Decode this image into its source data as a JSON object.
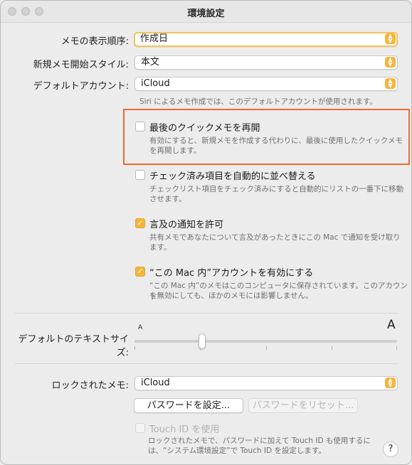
{
  "window": {
    "title": "環境設定"
  },
  "sort": {
    "label": "メモの表示順序:",
    "value": "作成日"
  },
  "new_note_style": {
    "label": "新規メモ開始スタイル:",
    "value": "本文"
  },
  "default_account": {
    "label": "デフォルトアカウント:",
    "value": "iCloud",
    "note": "Siri によるメモ作成では、このデフォルトアカウントが使用されます。"
  },
  "options": [
    {
      "label": "最後のクイックメモを再開",
      "checked": false,
      "note_line1": "有効にすると、新規メモを作成する代わりに、最後に使用したクイックメモ",
      "note_line2": "を再開します。"
    },
    {
      "label": "チェック済み項目を自動的に並べ替える",
      "checked": false,
      "note_line1": "チェックリスト項目をチェック済みにすると自動的にリストの一番下に移動",
      "note_line2": "させます。"
    },
    {
      "label": "言及の通知を許可",
      "checked": true,
      "note_line1": "共有メモであなたについて言及があったときにこの Mac で通知を受け取り",
      "note_line2": "ます。"
    },
    {
      "label": "“この Mac 内”アカウントを有効にする",
      "checked": true,
      "note_line1": "“この Mac 内”のメモはこのコンピュータに保存されています。このアカウント",
      "note_line2": "を無効にしても、ほかのメモには影響しません。"
    }
  ],
  "text_size": {
    "label": "デフォルトのテキストサイズ:",
    "small_glyph": "A",
    "large_glyph": "A"
  },
  "locked_notes": {
    "label": "ロックされたメモ:",
    "value": "iCloud",
    "set_password": "パスワードを設定...",
    "reset_password": "パスワードをリセット...",
    "touch_id_label": "Touch ID を使用",
    "note_line1": "ロックされたメモで、パスワードに加えて Touch ID も使用するに",
    "note_line2": "は、“システム環境設定”で Touch ID を設定します。"
  },
  "help": {
    "glyph": "?"
  },
  "colors": {
    "accent": "#f5b53b",
    "highlight_box": "#ee6a2d",
    "background": "#ececec"
  }
}
